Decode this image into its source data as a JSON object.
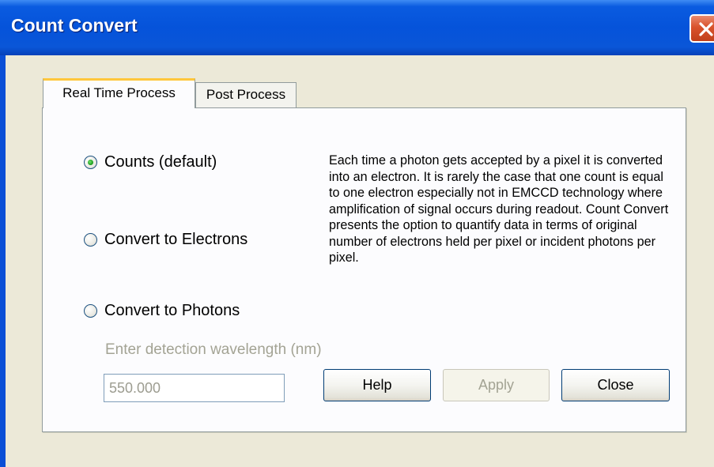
{
  "window": {
    "title": "Count Convert"
  },
  "tabs": [
    {
      "label": "Real Time Process",
      "active": true
    },
    {
      "label": "Post Process",
      "active": false
    }
  ],
  "options": [
    {
      "label": "Counts (default)",
      "selected": true
    },
    {
      "label": "Convert to Electrons",
      "selected": false
    },
    {
      "label": "Convert to Photons",
      "selected": false
    }
  ],
  "description": "Each time a photon gets accepted by a pixel it is converted into an electron.  It is rarely the case that one count is equal to one electron especially not in EMCCD technology where amplification of signal occurs during readout. Count Convert presents the option to quantify data in terms of original number of electrons held per pixel or incident photons per pixel.",
  "wavelength": {
    "label": "Enter detection wavelength (nm)",
    "value": "550.000",
    "enabled": false
  },
  "buttons": {
    "help": "Help",
    "apply": "Apply",
    "close": "Close"
  },
  "icons": {
    "close": "close-icon"
  },
  "colors": {
    "titlebar": "#0553da",
    "close_button": "#d9522c",
    "active_tab_accent": "#ffc73c",
    "selected_radio": "#21a121"
  }
}
